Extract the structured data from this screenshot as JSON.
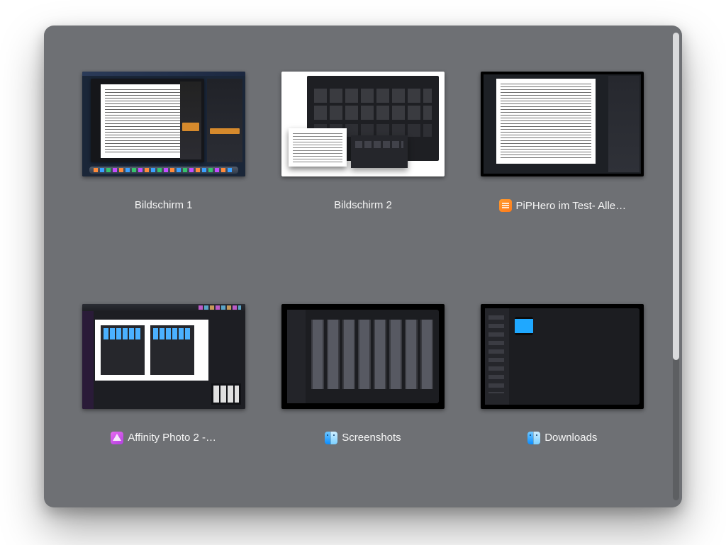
{
  "items": [
    {
      "label": "Bildschirm 1",
      "icon": null
    },
    {
      "label": "Bildschirm 2",
      "icon": null
    },
    {
      "label": "PiPHero im Test- Alle…",
      "icon": "pages"
    },
    {
      "label": "Affinity Photo 2 -…",
      "icon": "affinity"
    },
    {
      "label": "Screenshots",
      "icon": "finder"
    },
    {
      "label": "Downloads",
      "icon": "finder"
    }
  ]
}
